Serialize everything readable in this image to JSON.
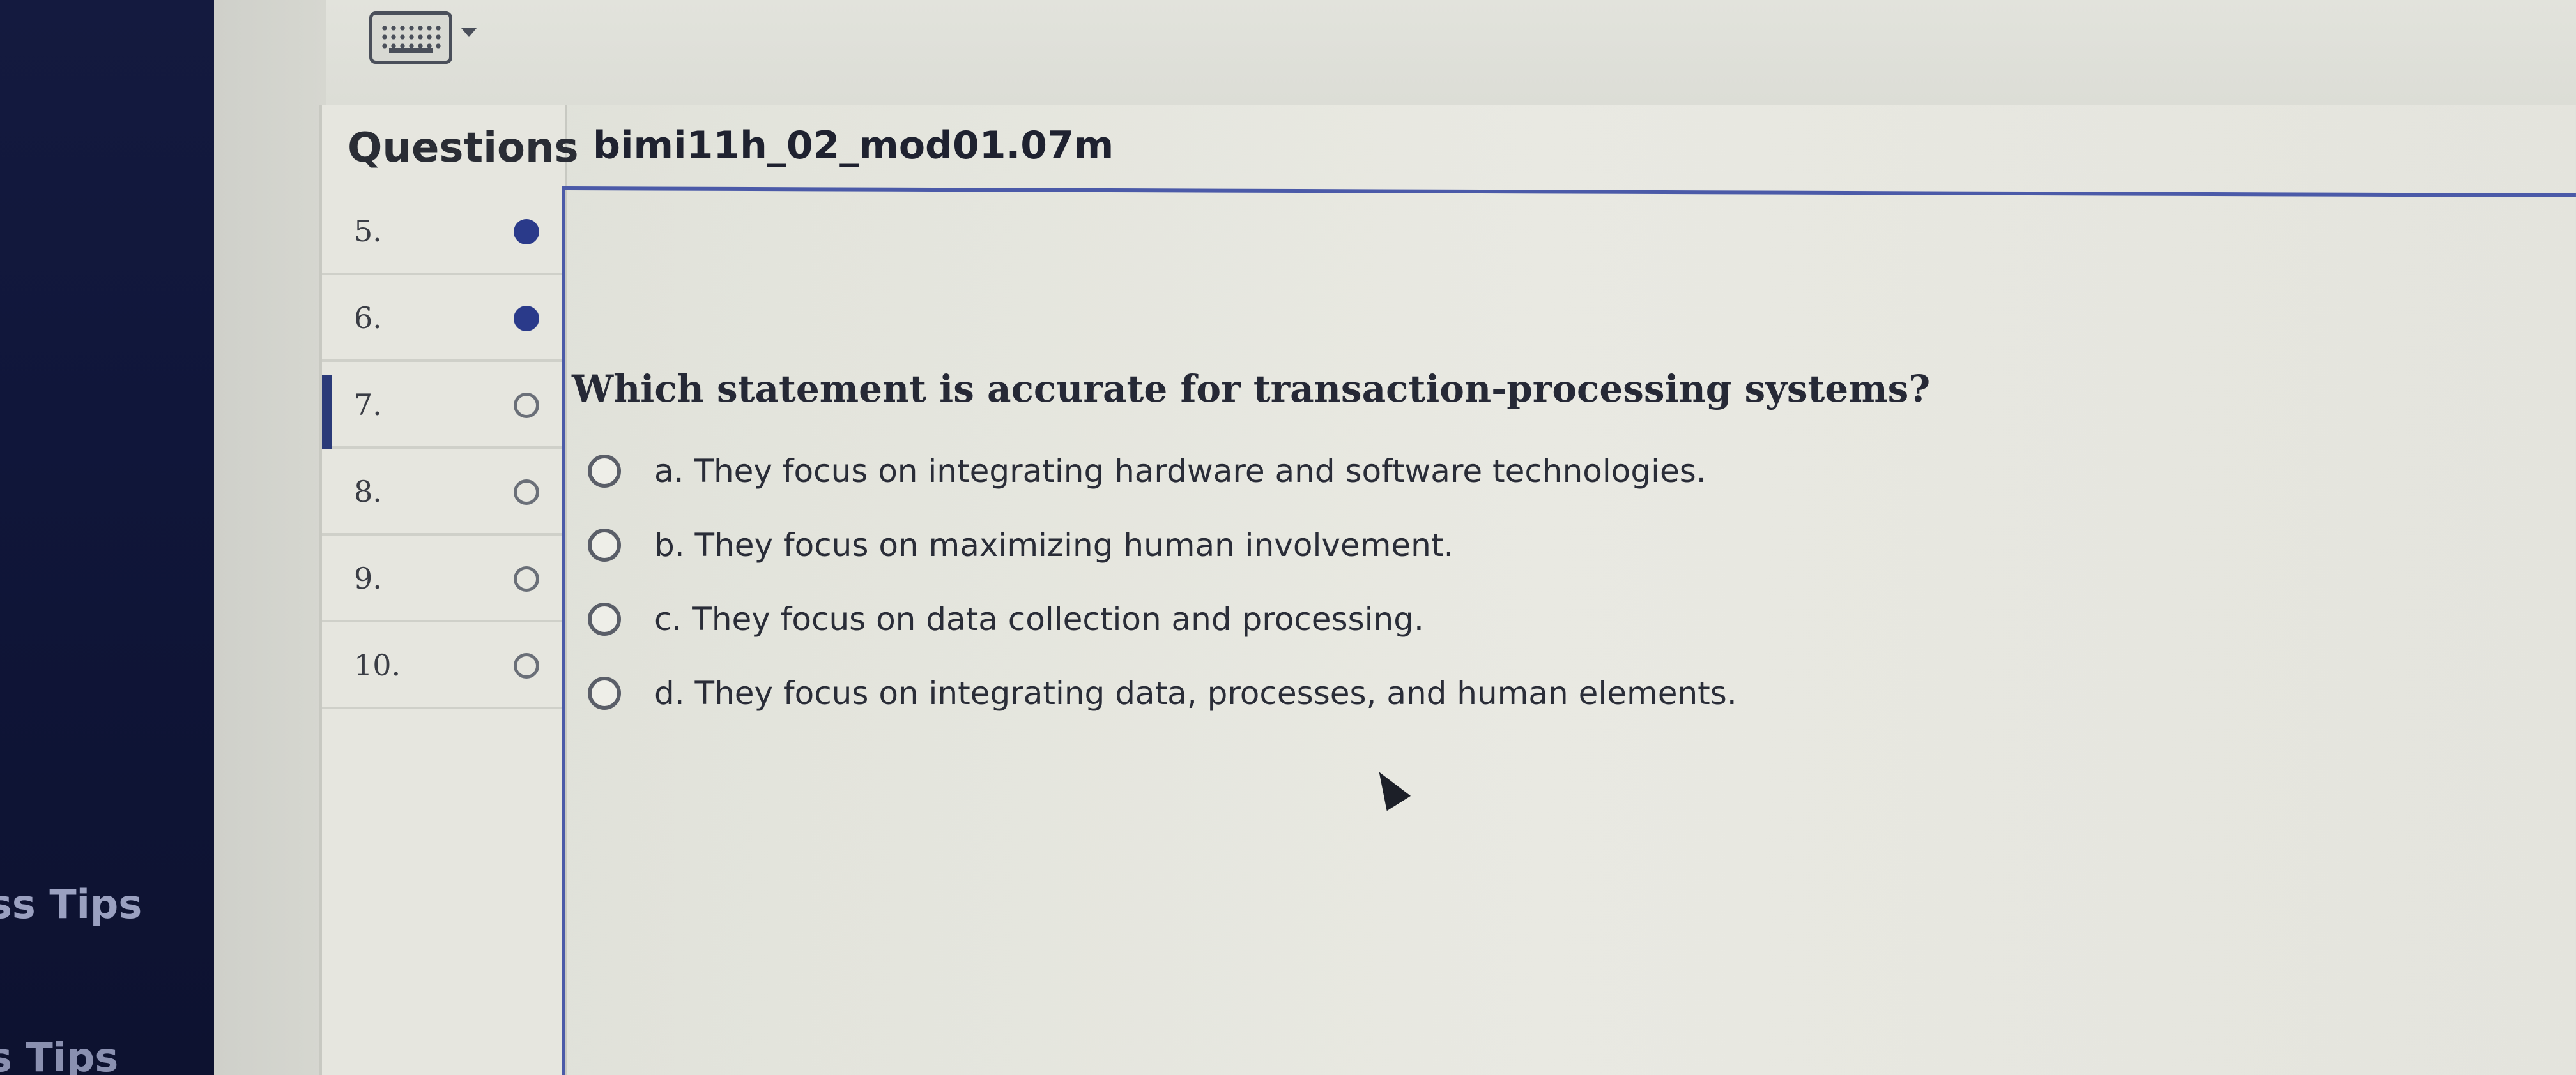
{
  "sidebar": {
    "tips_1": "ss Tips",
    "tips_2": "s Tips"
  },
  "toolbar": {
    "keyboard_icon": "keyboard-icon",
    "dropdown_icon": "caret-down-icon"
  },
  "questions_panel": {
    "header": "Questions",
    "items": [
      {
        "number": "5.",
        "status": "answered"
      },
      {
        "number": "6.",
        "status": "answered"
      },
      {
        "number": "7.",
        "status": "unanswered",
        "active": true
      },
      {
        "number": "8.",
        "status": "unanswered"
      },
      {
        "number": "9.",
        "status": "unanswered"
      },
      {
        "number": "10.",
        "status": "unanswered"
      }
    ]
  },
  "main": {
    "title": "bimi11h_02_mod01.07m",
    "question": "Which statement is accurate for transaction-processing systems?",
    "options": [
      {
        "label": "a. They focus on integrating hardware and software technologies."
      },
      {
        "label": "b. They focus on maximizing human involvement."
      },
      {
        "label": "c. They focus on data collection and processing."
      },
      {
        "label": "d. They focus on integrating data, processes, and human elements."
      }
    ]
  },
  "colors": {
    "accent": "#2a3a8a",
    "sidebar_bg": "#10163a",
    "divider": "#4b5aa8"
  }
}
